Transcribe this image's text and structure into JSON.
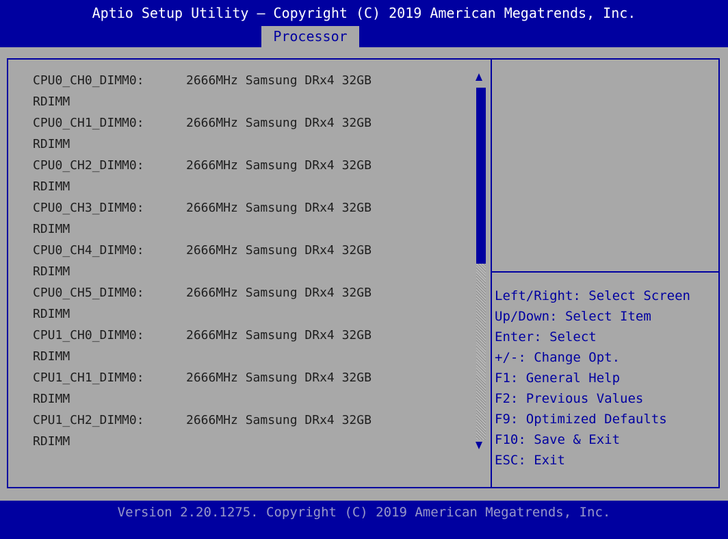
{
  "header": {
    "title": "Aptio Setup Utility – Copyright (C) 2019 American Megatrends, Inc.",
    "tabs": [
      {
        "label": "Processor",
        "active": true
      }
    ]
  },
  "memory_list": [
    {
      "slot": "CPU0_CH0_DIMM0:",
      "value": "2666MHz Samsung DRx4 32GB",
      "type": "RDIMM"
    },
    {
      "slot": "CPU0_CH1_DIMM0:",
      "value": "2666MHz Samsung DRx4 32GB",
      "type": "RDIMM"
    },
    {
      "slot": "CPU0_CH2_DIMM0:",
      "value": "2666MHz Samsung DRx4 32GB",
      "type": "RDIMM"
    },
    {
      "slot": "CPU0_CH3_DIMM0:",
      "value": "2666MHz Samsung DRx4 32GB",
      "type": "RDIMM"
    },
    {
      "slot": "CPU0_CH4_DIMM0:",
      "value": "2666MHz Samsung DRx4 32GB",
      "type": "RDIMM"
    },
    {
      "slot": "CPU0_CH5_DIMM0:",
      "value": "2666MHz Samsung DRx4 32GB",
      "type": "RDIMM"
    },
    {
      "slot": "CPU1_CH0_DIMM0:",
      "value": "2666MHz Samsung DRx4 32GB",
      "type": "RDIMM"
    },
    {
      "slot": "CPU1_CH1_DIMM0:",
      "value": "2666MHz Samsung DRx4 32GB",
      "type": "RDIMM"
    },
    {
      "slot": "CPU1_CH2_DIMM0:",
      "value": "2666MHz Samsung DRx4 32GB",
      "type": "RDIMM"
    }
  ],
  "scrollbar": {
    "up_icon": "arrow-up-icon",
    "down_icon": "arrow-down-icon",
    "visible_fraction": 0.5,
    "position_fraction": 0.0
  },
  "help": [
    "Left/Right: Select Screen",
    "Up/Down: Select Item",
    "Enter: Select",
    "+/-: Change Opt.",
    "F1: General Help",
    "F2: Previous Values",
    "F9: Optimized Defaults",
    "F10: Save & Exit",
    "ESC: Exit"
  ],
  "footer": {
    "version": "Version 2.20.1275. Copyright (C) 2019 American Megatrends, Inc."
  },
  "colors": {
    "bios_blue": "#0000a0",
    "bios_gray": "#a8a8a8",
    "text_dark": "#1e1e1e",
    "footer_text": "#9898c8"
  }
}
